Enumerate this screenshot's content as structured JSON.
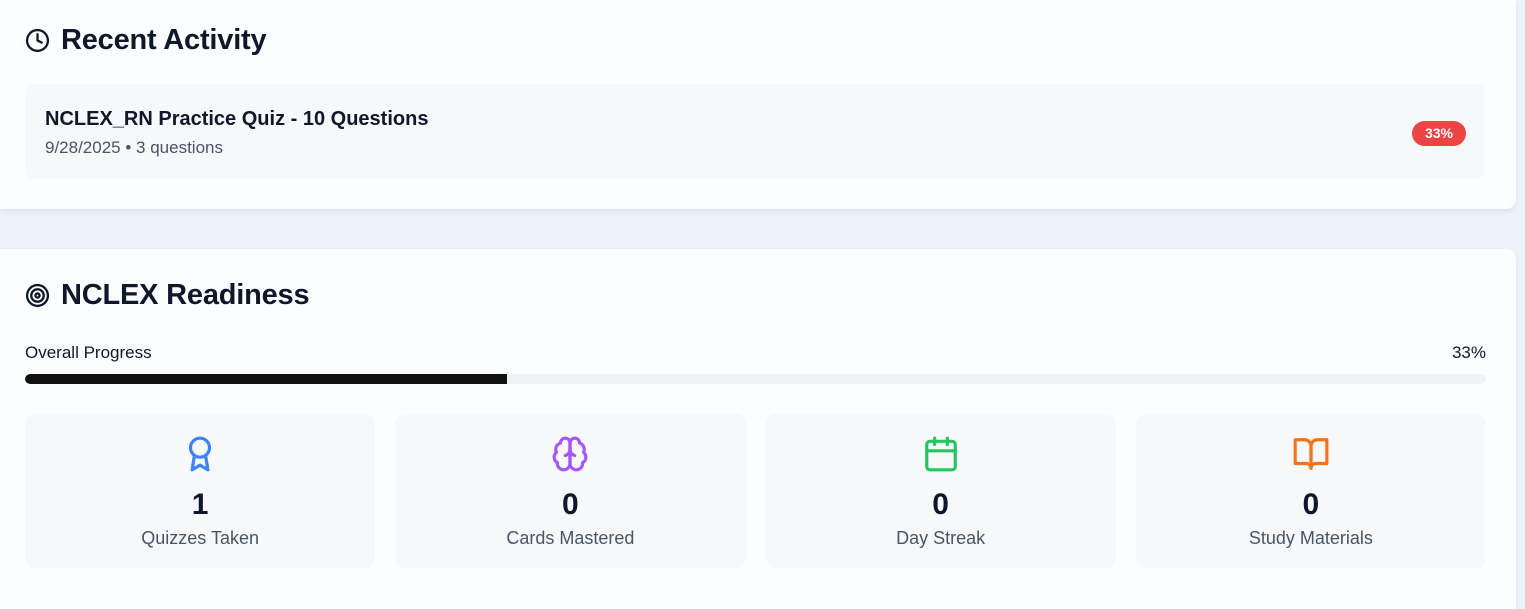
{
  "recent": {
    "title": "Recent Activity",
    "icon": "clock-icon",
    "items": [
      {
        "title": "NCLEX_RN Practice Quiz - 10 Questions",
        "meta": "9/28/2025 • 3 questions",
        "score": "33%",
        "score_color": "#ef4444"
      }
    ]
  },
  "readiness": {
    "title": "NCLEX Readiness",
    "icon": "target-icon",
    "progress_label": "Overall Progress",
    "progress_text": "33%",
    "progress_fraction": 0.33,
    "stats": [
      {
        "value": "1",
        "label": "Quizzes Taken",
        "icon": "award-icon",
        "color": "#3b82f6"
      },
      {
        "value": "0",
        "label": "Cards Mastered",
        "icon": "brain-icon",
        "color": "#a855f7"
      },
      {
        "value": "0",
        "label": "Day Streak",
        "icon": "calendar-icon",
        "color": "#22c55e"
      },
      {
        "value": "0",
        "label": "Study Materials",
        "icon": "book-open-icon",
        "color": "#f97316"
      }
    ]
  }
}
